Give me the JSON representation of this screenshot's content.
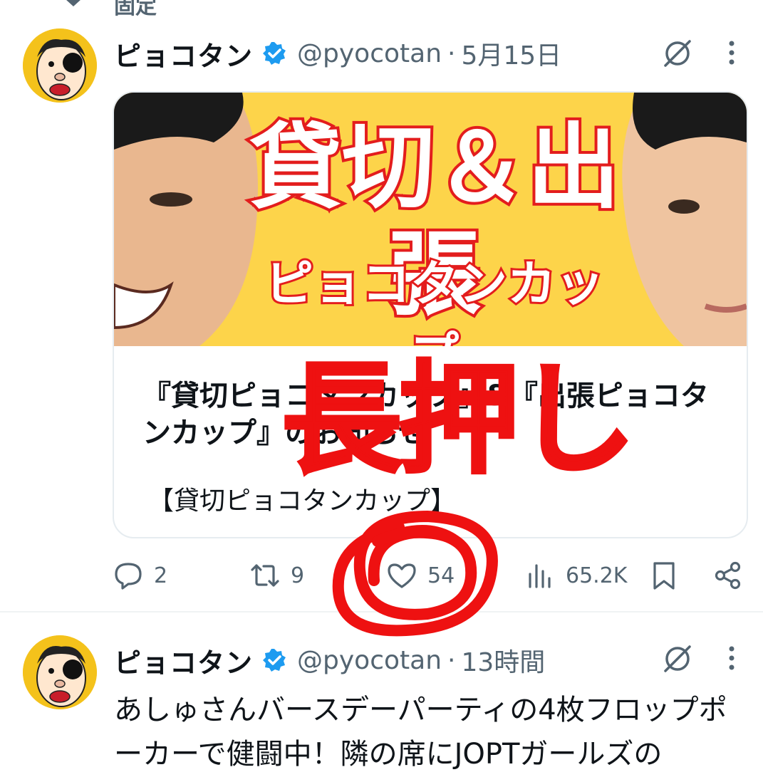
{
  "pinned": {
    "label": "固定",
    "icon": "pin-icon"
  },
  "tweet1": {
    "name": "ピョコタン",
    "handle": "@pyocotan",
    "dot": "·",
    "time": "5月15日",
    "card": {
      "thumb_line1": "貸切＆出張",
      "thumb_line2": "ピョコタンカップ",
      "title": "『貸切ピョコタンカップ』&『出張ピョコタンカップ』のお知らせ",
      "description": "【貸切ピョコタンカップ】"
    },
    "actions": {
      "replies": "2",
      "reposts": "9",
      "likes": "54",
      "views": "65.2K"
    }
  },
  "tweet2": {
    "name": "ピョコタン",
    "handle": "@pyocotan",
    "dot": "·",
    "time": "13時間",
    "text": "あしゅさんバースデーパーティの4枚フロップポーカーで健闘中！隣の席にJOPTガールズの"
  },
  "annotation": {
    "text": "長押し",
    "color": "#ee1111"
  },
  "colors": {
    "accent": "#1d9bf0",
    "muted": "#536471",
    "thumb_bg": "#fdd44a",
    "avatar_bg": "#f4c21b"
  }
}
